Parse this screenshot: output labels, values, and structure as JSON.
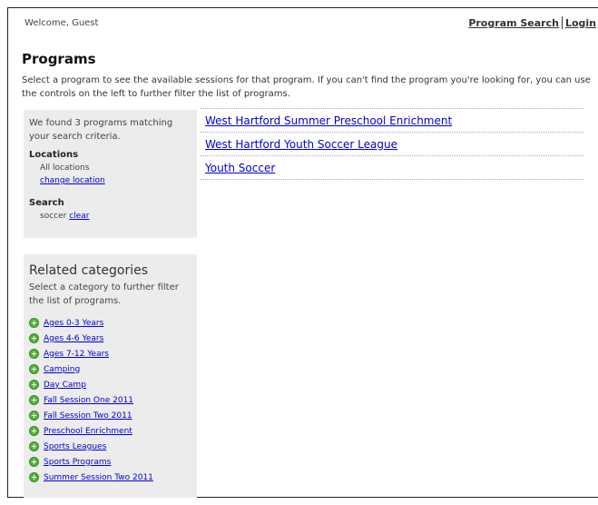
{
  "header": {
    "welcome": "Welcome, Guest",
    "program_search": "Program Search",
    "login": "Login"
  },
  "page": {
    "title": "Programs",
    "intro": "Select a program to see the available sessions for that program. If you can't find the program you're looking for, you can use the controls on the left to further filter the list of programs."
  },
  "filters": {
    "found": "We found 3 programs matching your search criteria.",
    "locations_heading": "Locations",
    "locations_value": "All locations",
    "change_location": "change location",
    "search_heading": "Search",
    "search_value": "soccer",
    "clear": "clear"
  },
  "related": {
    "title": "Related categories",
    "description": "Select a category to further filter the list of programs.",
    "items": [
      "Ages 0-3 Years",
      "Ages 4-6 Years",
      "Ages 7-12 Years",
      "Camping",
      "Day Camp",
      "Fall Session One 2011",
      "Fall Session Two 2011",
      "Preschool Enrichment",
      "Sports Leagues",
      "Sports Programs",
      "Summer Session Two 2011"
    ]
  },
  "programs": [
    "West Hartford Summer Preschool Enrichment",
    "West Hartford Youth Soccer League",
    "Youth Soccer"
  ],
  "colors": {
    "link": "#0000cc",
    "panel_bg": "#ececec",
    "plus_icon": "#58b23a"
  },
  "icons": {
    "category": "plus-circle-icon"
  }
}
